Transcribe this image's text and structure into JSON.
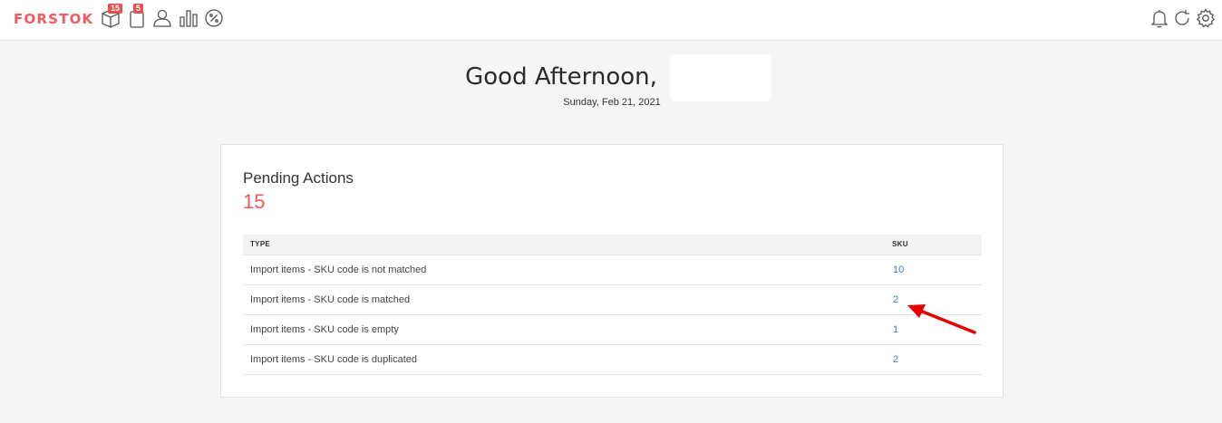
{
  "app": {
    "logo": "FORSTOK"
  },
  "nav": {
    "items": [
      {
        "icon": "box-icon",
        "badge": "15"
      },
      {
        "icon": "clipboard-icon",
        "badge": "5"
      },
      {
        "icon": "user-icon"
      },
      {
        "icon": "bar-chart-icon"
      },
      {
        "icon": "percent-icon"
      }
    ],
    "right_icons": [
      "bell-icon",
      "refresh-icon",
      "gear-icon"
    ]
  },
  "greeting": {
    "text": "Good Afternoon,",
    "date": "Sunday, Feb 21, 2021"
  },
  "pending": {
    "title": "Pending Actions",
    "count": "15",
    "table": {
      "headers": {
        "type": "TYPE",
        "sku": "SKU"
      },
      "rows": [
        {
          "type": "Import items - SKU code is not matched",
          "sku": "10"
        },
        {
          "type": "Import items - SKU code is matched",
          "sku": "2"
        },
        {
          "type": "Import items - SKU code is empty",
          "sku": "1"
        },
        {
          "type": "Import items - SKU code is duplicated",
          "sku": "2"
        }
      ]
    }
  },
  "colors": {
    "brand": "#f25a62",
    "link": "#3b7dc4",
    "badge": "#e8504d",
    "annotation": "#e60000"
  }
}
